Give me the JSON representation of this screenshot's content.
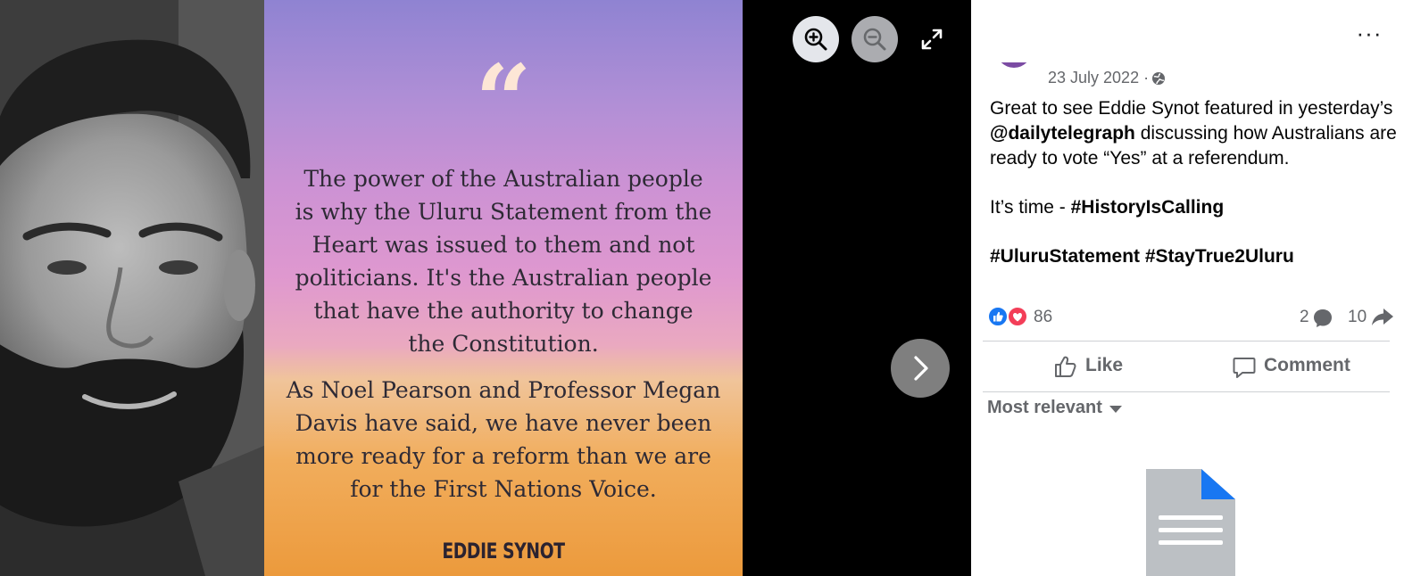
{
  "viewer": {
    "quote_mark": "“",
    "quote": {
      "paragraph_1": [
        "The power of the Australian people",
        "is why the Uluru Statement from the",
        "Heart was issued to them and not",
        "politicians. It's the Australian people",
        "that have the authority to change",
        "the Constitution."
      ],
      "paragraph_2": [
        "As Noel Pearson and Professor Megan",
        "Davis have said, we have never been",
        "more ready for a reform than we are",
        "for the First Nations Voice."
      ],
      "author": "EDDIE SYNOT"
    },
    "controls": {
      "zoom_in_icon": "zoom-in-icon",
      "zoom_out_icon": "zoom-out-icon",
      "fullscreen_icon": "expand-icon",
      "next_icon": "chevron-right-icon"
    }
  },
  "post": {
    "date": "23 July 2022 ·",
    "privacy_icon": "globe-icon",
    "more_label": "···",
    "text": {
      "line_1": "Great to see Eddie Synot featured in yesterday’s",
      "mention": "@dailytelegraph",
      "line_2_rest": " discussing how Australians are",
      "line_3": "ready to vote “Yes” at a referendum.",
      "line_4_prefix": "It’s time - ",
      "hashtag_1": "#HistoryIsCalling",
      "hashtag_2": "#UluruStatement",
      "hashtag_3": "#StayTrue2Uluru"
    },
    "stats": {
      "reactions": "86",
      "comments": "2",
      "shares": "10"
    },
    "actions": {
      "like": "Like",
      "comment": "Comment"
    },
    "sort": {
      "selected": "Most relevant"
    },
    "colors": {
      "like_blue": "#1877f2",
      "love_red": "#f33e58",
      "muted_text": "#65676b"
    }
  }
}
